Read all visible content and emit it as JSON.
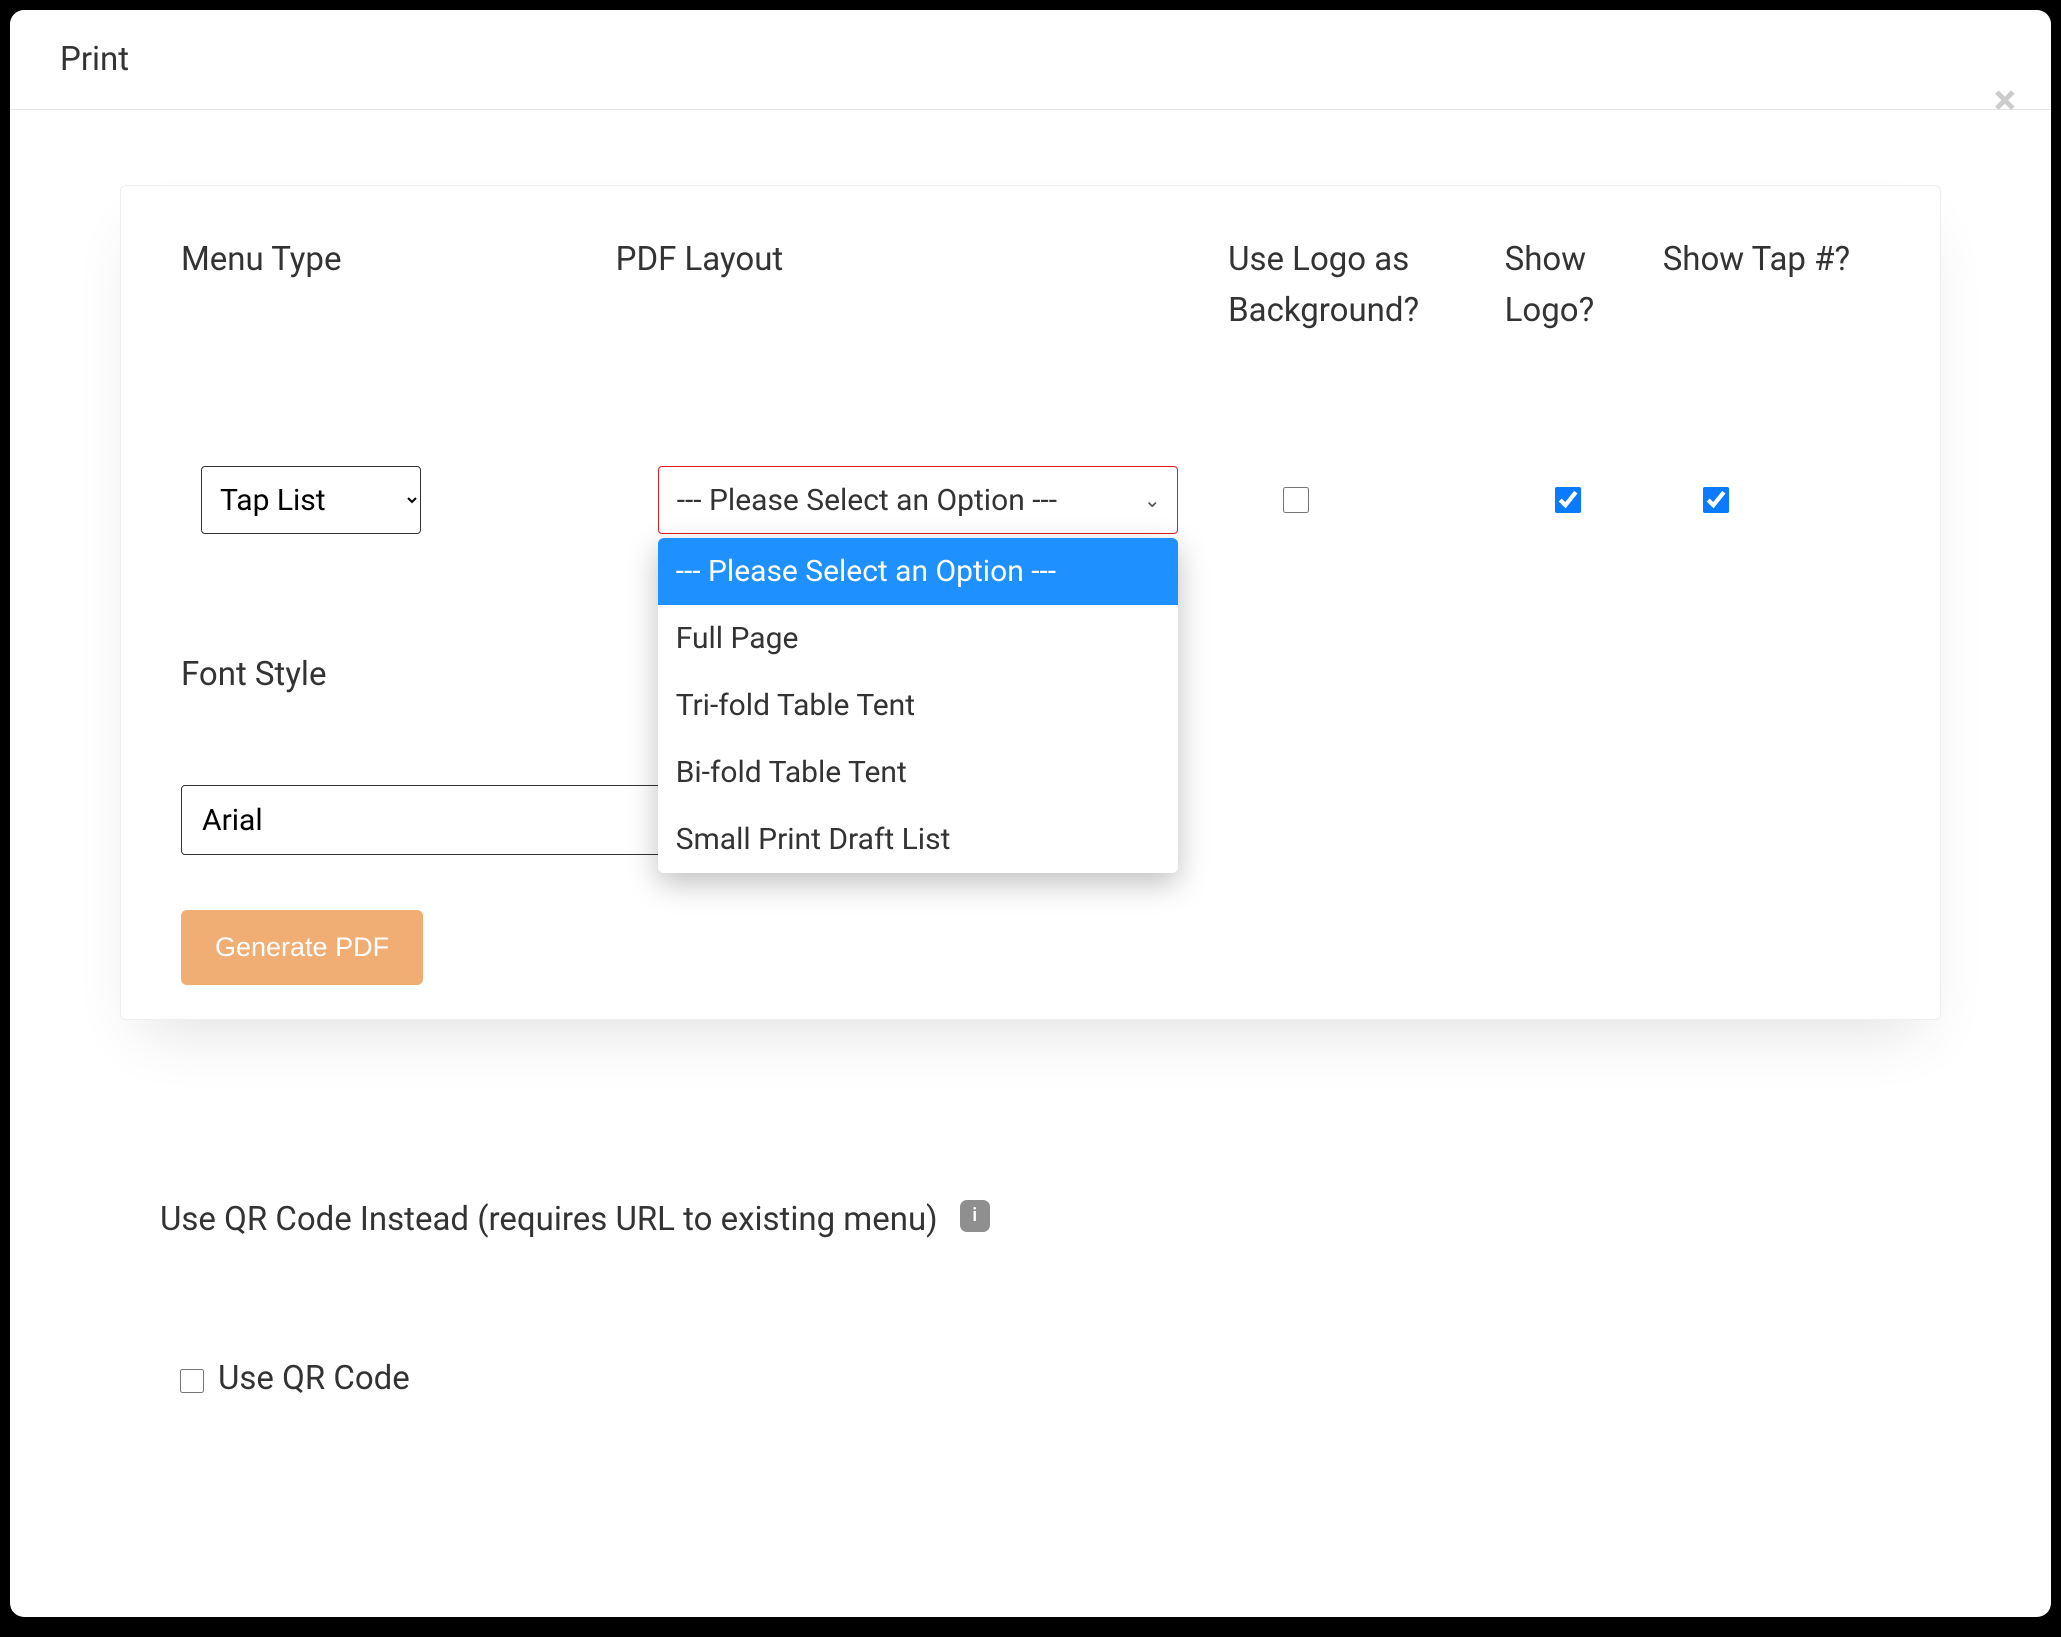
{
  "modal": {
    "title": "Print"
  },
  "labels": {
    "menu_type": "Menu Type",
    "pdf_layout": "PDF Layout",
    "use_logo_bg": "Use Logo as Background?",
    "show_logo": "Show Logo?",
    "show_tap": "Show Tap #?",
    "font_style": "Font Style"
  },
  "menu_type": {
    "selected": "Tap List"
  },
  "pdf_layout": {
    "selected": "--- Please Select an Option ---",
    "options": [
      "--- Please Select an Option ---",
      "Full Page",
      "Tri-fold Table Tent",
      "Bi-fold Table Tent",
      "Small Print Draft List"
    ]
  },
  "checks": {
    "use_logo_bg": false,
    "show_logo": true,
    "show_tap": true
  },
  "font_style": {
    "selected": "Arial"
  },
  "buttons": {
    "generate": "Generate PDF"
  },
  "qr": {
    "section_label": "Use QR Code Instead (requires URL to existing menu)",
    "info_char": "i",
    "checkbox_label": "Use QR Code",
    "checked": false
  }
}
